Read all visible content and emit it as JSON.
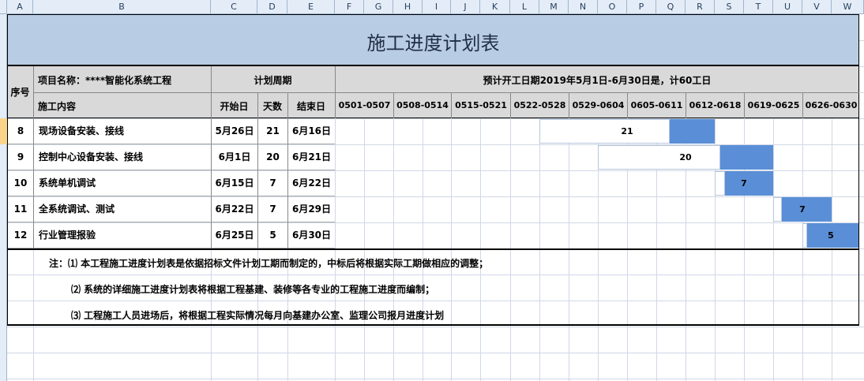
{
  "column_letters": [
    "A",
    "B",
    "C",
    "D",
    "E",
    "F",
    "G",
    "H",
    "I",
    "J",
    "K",
    "L",
    "M",
    "N",
    "O",
    "P",
    "Q",
    "R",
    "S",
    "T",
    "U",
    "V",
    "W"
  ],
  "title": "施工进度计划表",
  "header": {
    "seq": "序号",
    "project_name": "项目名称：****智能化系统工程",
    "plan_period": "计划周期",
    "schedule_note": "预计开工日期2019年5月1日-6月30日是，计60工日",
    "content": "施工内容",
    "start": "开始日",
    "days": "天数",
    "end": "结束日",
    "weeks": [
      "0501-0507",
      "0508-0514",
      "0515-0521",
      "0522-0528",
      "0529-0604",
      "0605-0611",
      "0612-0618",
      "0619-0625",
      "0626-0630"
    ]
  },
  "rows": [
    {
      "seq": "8",
      "content": "现场设备安装、接线",
      "start": "5月26日",
      "days": "21",
      "end": "6月16日",
      "bar_label": "21"
    },
    {
      "seq": "9",
      "content": "控制中心设备安装、接线",
      "start": "6月1日",
      "days": "20",
      "end": "6月21日",
      "bar_label": "20"
    },
    {
      "seq": "10",
      "content": "系统单机调试",
      "start": "6月15日",
      "days": "7",
      "end": "6月22日",
      "bar_label": "7"
    },
    {
      "seq": "11",
      "content": "全系统调试、测试",
      "start": "6月22日",
      "days": "7",
      "end": "6月29日",
      "bar_label": "7"
    },
    {
      "seq": "12",
      "content": "行业管理报验",
      "start": "6月25日",
      "days": "5",
      "end": "6月30日",
      "bar_label": "5"
    }
  ],
  "notes": [
    "注：⑴ 本工程施工进度计划表是依据招标文件计划工期而制定的，中标后将根据实际工期做相应的调整；",
    "⑵ 系统的详细施工进度计划表将根据工程基建、装修等各专业的工程施工进度而编制；",
    "⑶ 工程施工人员进场后，将根据工程实际情况每月向基建办公室、监理公司报月进度计划"
  ],
  "colors": {
    "header_fill": "#b8cce4",
    "gray_fill": "#d9d9d9",
    "bar": "#5a8fd7",
    "sheet_header": "#e4ecf7"
  }
}
